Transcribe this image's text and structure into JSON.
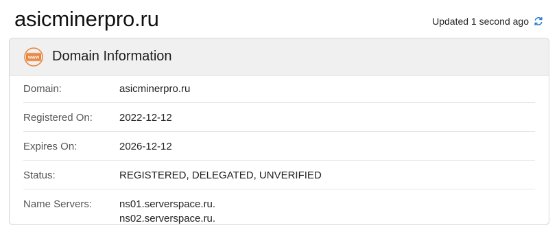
{
  "page": {
    "domain_title": "asicminerpro.ru",
    "updated_text": "Updated 1 second ago",
    "refresh_icon": "refresh-icon"
  },
  "card": {
    "header_title": "Domain Information",
    "header_icon": "www-icon",
    "icon_text": "www",
    "accent_color": "#e8853d",
    "rows": [
      {
        "label": "Domain:",
        "value": "asicminerpro.ru"
      },
      {
        "label": "Registered On:",
        "value": "2022-12-12"
      },
      {
        "label": "Expires On:",
        "value": "2026-12-12"
      },
      {
        "label": "Status:",
        "value": "REGISTERED, DELEGATED, UNVERIFIED"
      },
      {
        "label": "Name Servers:",
        "values": [
          "ns01.serverspace.ru.",
          "ns02.serverspace.ru."
        ]
      }
    ]
  }
}
